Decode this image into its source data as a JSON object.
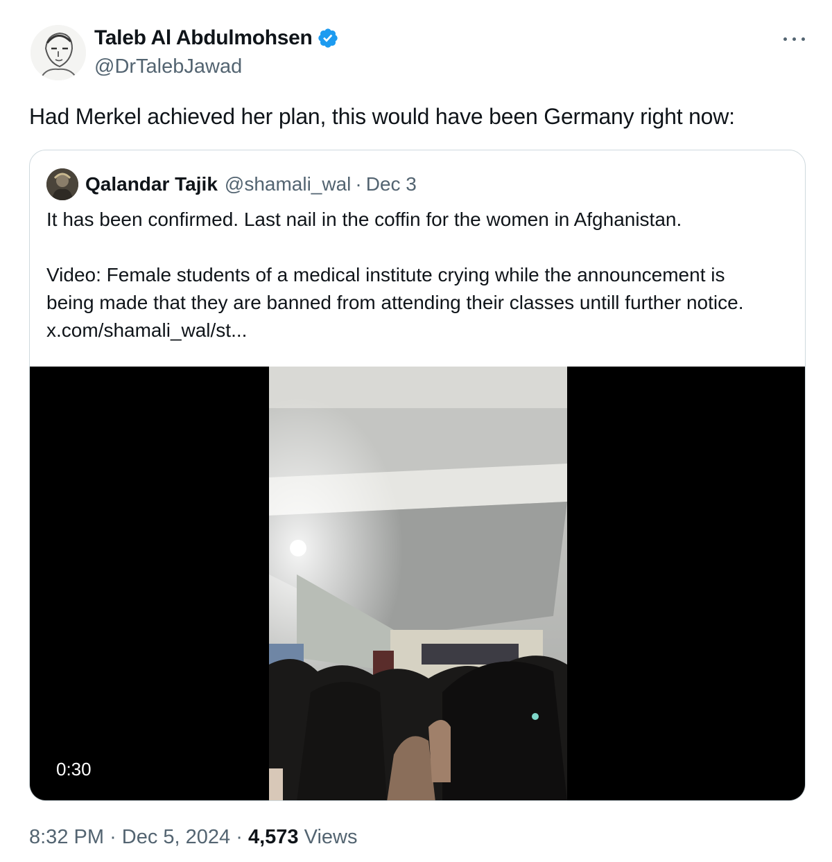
{
  "author": {
    "name": "Taleb Al Abdulmohsen",
    "handle": "@DrTalebJawad",
    "verified": true,
    "avatar_icon": "sketch-portrait-avatar"
  },
  "tweet": {
    "text": "Had Merkel achieved her plan, this would have been Germany right now:"
  },
  "quoted": {
    "name": "Qalandar Tajik",
    "handle": "@shamali_wal",
    "separator": "·",
    "date": "Dec 3",
    "text_line1": "It has been confirmed. Last nail in the coffin for the women in Afghanistan.",
    "text_line2": "Video: Female students of a medical institute crying while the announcement is being made that they are banned from attending their classes untill further notice.",
    "link": "x.com/shamali_wal/st...",
    "video_duration": "0:30"
  },
  "footer": {
    "time": "8:32 PM",
    "sep": "·",
    "date": "Dec 5, 2024",
    "views_count": "4,573",
    "views_label": "Views"
  },
  "colors": {
    "text": "#0f1419",
    "secondary": "#536471",
    "verified": "#1d9bf0",
    "border": "#cfd9de"
  }
}
